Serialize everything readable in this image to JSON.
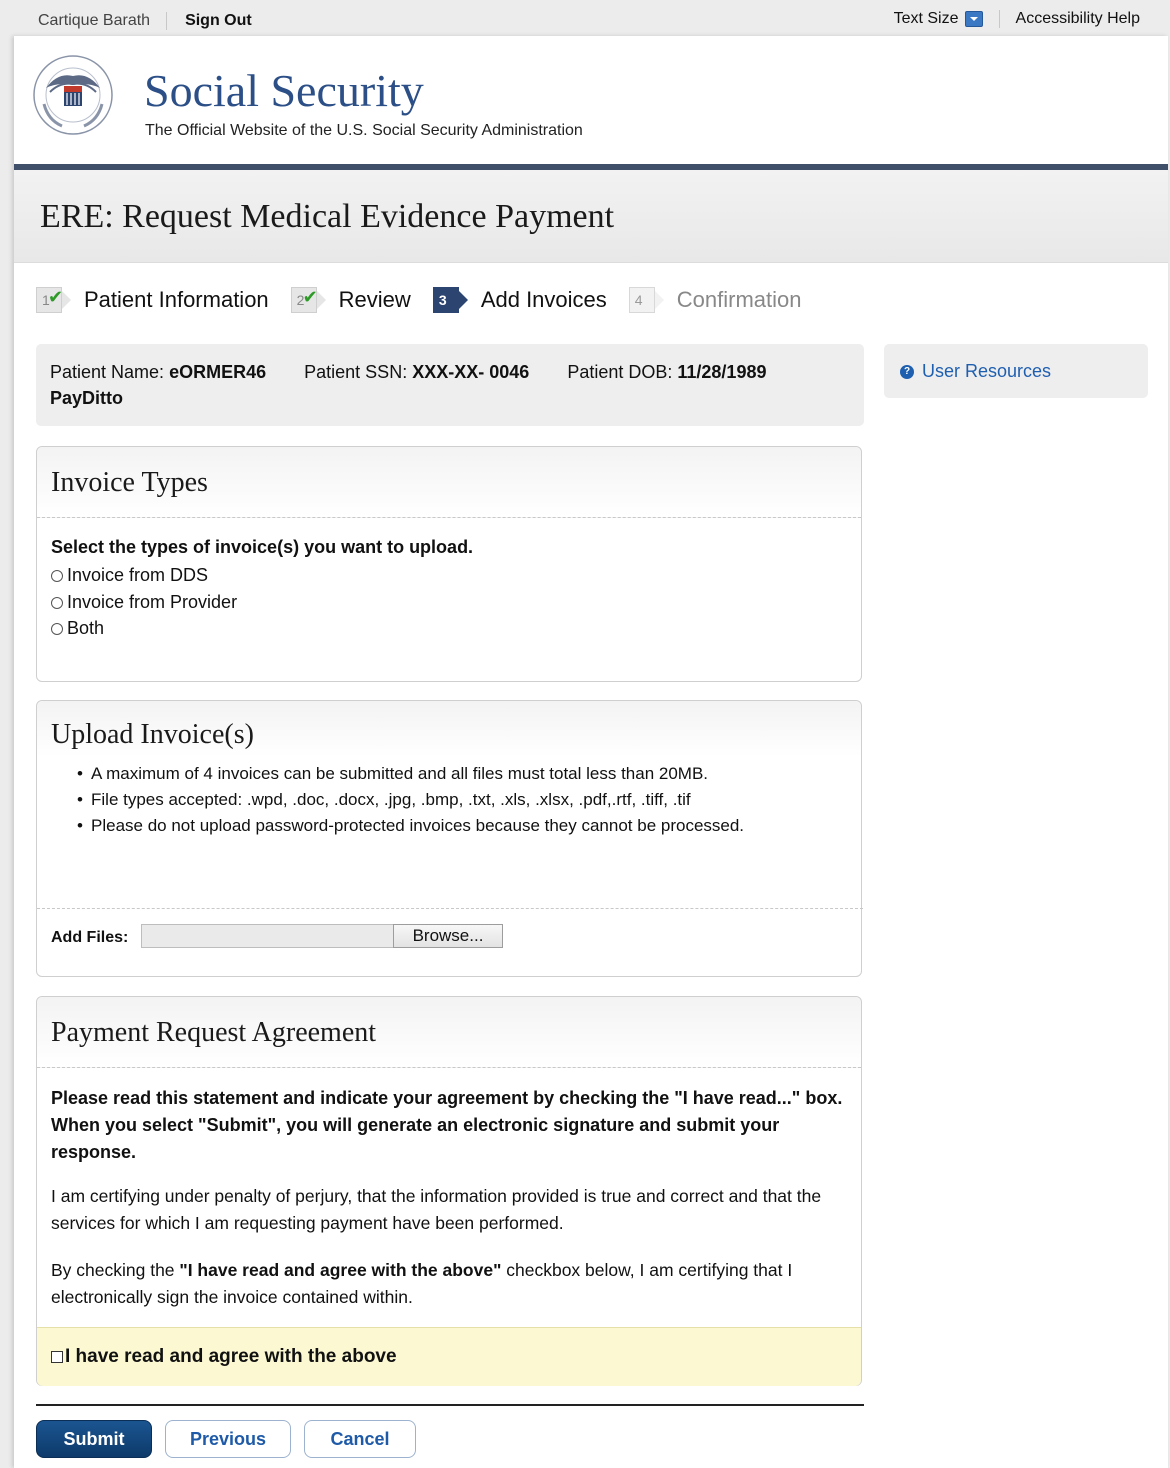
{
  "topbar": {
    "user_name": "Cartique Barath",
    "sign_out": "Sign Out",
    "text_size": "Text Size",
    "accessibility_help": "Accessibility Help"
  },
  "header": {
    "title": "Social Security",
    "subtitle": "The Official Website of the U.S. Social Security Administration"
  },
  "page_title": "ERE: Request Medical Evidence Payment",
  "steps": [
    {
      "number": "1",
      "label": "Patient Information",
      "status": "complete"
    },
    {
      "number": "2",
      "label": "Review",
      "status": "complete"
    },
    {
      "number": "3",
      "label": "Add Invoices",
      "status": "current"
    },
    {
      "number": "4",
      "label": "Confirmation",
      "status": "upcoming"
    }
  ],
  "patient": {
    "name_label": "Patient Name:",
    "name_first": "eORMER46",
    "name_last": "PayDitto",
    "ssn_label": "Patient SSN:",
    "ssn_value": "XXX-XX- 0046",
    "dob_label": "Patient DOB:",
    "dob_value": "11/28/1989"
  },
  "resources": {
    "link": "User Resources"
  },
  "invoice_types": {
    "title": "Invoice Types",
    "prompt": "Select the types of invoice(s) you want to upload.",
    "options": [
      "Invoice from DDS",
      "Invoice from Provider",
      "Both"
    ]
  },
  "upload": {
    "title": "Upload Invoice(s)",
    "bullets": [
      "A maximum of 4 invoices can be submitted and all files must total less than 20MB.",
      "File types accepted: .wpd, .doc, .docx, .jpg, .bmp, .txt, .xls, .xlsx, .pdf,.rtf, .tiff, .tif",
      "Please do not upload password-protected invoices because they cannot be processed."
    ],
    "add_files_label": "Add Files:",
    "file_value": "",
    "browse": "Browse..."
  },
  "agreement": {
    "title": "Payment Request Agreement",
    "instructions": "Please read this statement and indicate your agreement by checking the \"I have read...\" box. When you select \"Submit\", you will generate an electronic signature and submit your response.",
    "certify": "I am certifying under penalty of perjury, that the information provided is true and correct and that the services for which I am requesting payment have been performed.",
    "p2_prefix": "By checking the ",
    "p2_bold": "\"I have read and agree with the above\"",
    "p2_suffix": " checkbox below, I am certifying that I electronically sign the invoice contained within.",
    "checkbox_label": "I have read and agree with the above",
    "checked": false
  },
  "buttons": {
    "submit": "Submit",
    "previous": "Previous",
    "cancel": "Cancel"
  },
  "colors": {
    "brand_blue": "#2b4f86",
    "link_blue": "#1f5fb0",
    "step_current": "#2c4470",
    "check_green": "#2e9a27",
    "agree_bg": "#fbf8d2"
  }
}
